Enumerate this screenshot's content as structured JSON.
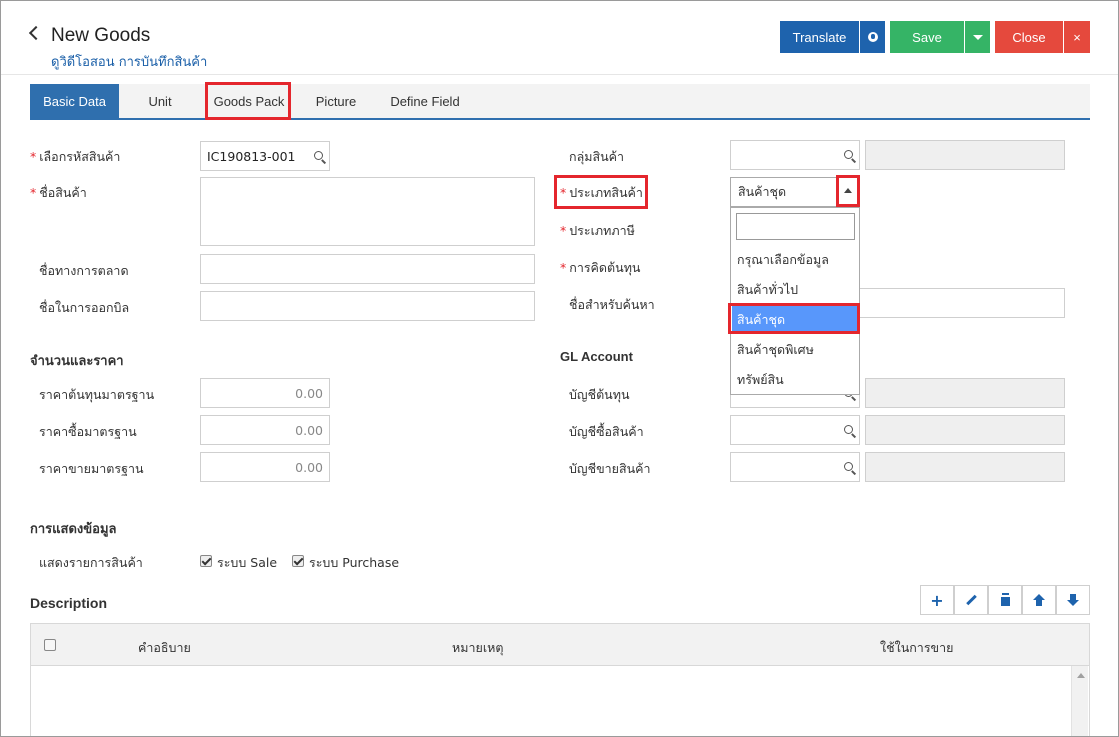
{
  "header": {
    "title": "New Goods",
    "video_link": "ดูวิดีโอสอน การบันทึกสินค้า",
    "translate_label": "Translate",
    "save_label": "Save",
    "close_label": "Close",
    "close_x": "×"
  },
  "tabs": [
    {
      "label": "Basic Data",
      "active": true
    },
    {
      "label": "Unit"
    },
    {
      "label": "Goods Pack"
    },
    {
      "label": "Picture"
    },
    {
      "label": "Define Field"
    }
  ],
  "form_left": {
    "code_label": "เลือกรหัสสินค้า",
    "code_value": "IC190813-001",
    "name_label": "ชื่อสินค้า",
    "marketing_name_label": "ชื่อทางการตลาด",
    "billing_name_label": "ชื่อในการออกบิล"
  },
  "form_right": {
    "group_label": "กลุ่มสินค้า",
    "type_label": "ประเภทสินค้า",
    "type_value": "สินค้าชุด",
    "tax_label": "ประเภทภาษี",
    "costing_label": "การคิดต้นทุน",
    "search_name_label": "ชื่อสำหรับค้นหา"
  },
  "dropdown": {
    "options": [
      "กรุณาเลือกข้อมูล",
      "สินค้าทั่วไป",
      "สินค้าชุด",
      "สินค้าชุดพิเศษ",
      "ทรัพย์สิน"
    ],
    "selected_index": 2
  },
  "price_section": {
    "title": "จำนวนและราคา",
    "std_cost_label": "ราคาต้นทุนมาตรฐาน",
    "std_cost_value": "0.00",
    "std_buy_label": "ราคาซื้อมาตรฐาน",
    "std_buy_value": "0.00",
    "std_sell_label": "ราคาขายมาตรฐาน",
    "std_sell_value": "0.00"
  },
  "gl_section": {
    "title": "GL Account",
    "cost_account_label": "บัญชีต้นทุน",
    "purchase_account_label": "บัญชีซื้อสินค้า",
    "sales_account_label": "บัญชีขายสินค้า"
  },
  "display_section": {
    "title": "การแสดงข้อมูล",
    "show_items_label": "แสดงรายการสินค้า",
    "sale_label": "ระบบ Sale",
    "sale_checked": true,
    "purchase_label": "ระบบ Purchase",
    "purchase_checked": true
  },
  "description": {
    "title": "Description",
    "add_symbol": "+",
    "columns": [
      "คำอธิบาย",
      "หมายเหตุ",
      "ใช้ในการขาย"
    ]
  }
}
